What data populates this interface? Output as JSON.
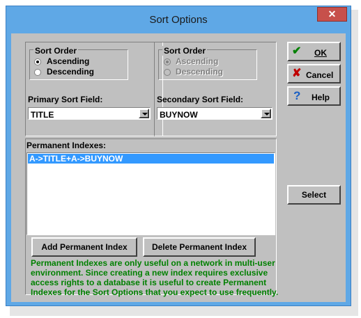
{
  "window": {
    "title": "Sort Options",
    "close_glyph": "✕"
  },
  "primary": {
    "group_label": "Sort Order",
    "ascending_label": "Ascending",
    "descending_label": "Descending",
    "selected": "Ascending",
    "field_label": "Primary Sort Field:",
    "field_value": "TITLE"
  },
  "secondary": {
    "group_label": "Sort Order",
    "ascending_label": "Ascending",
    "descending_label": "Descending",
    "selected": "Ascending",
    "field_label": "Secondary Sort Field:",
    "field_value": "BUYNOW"
  },
  "indexes": {
    "label": "Permanent Indexes:",
    "items": [
      "A->TITLE+A->BUYNOW"
    ],
    "selected_index": 0
  },
  "buttons": {
    "ok": "OK",
    "cancel": "Cancel",
    "help": "Help",
    "select": "Select",
    "add_index": "Add Permanent Index",
    "delete_index": "Delete Permanent Index"
  },
  "icons": {
    "ok": "checkmark-icon",
    "cancel": "x-icon",
    "help": "question-mark-icon"
  },
  "note": {
    "lines": [
      "Permanent Indexes are only useful on a network in multi-user",
      "environment. Since creating a new index requires exclusive",
      "access rights to a database it is useful to create Permanent",
      "Indexes for the Sort Options that you expect to use frequently."
    ]
  },
  "colors": {
    "note_text": "#008000",
    "selection": "#3399ff",
    "dialog_face": "#c0c0c0",
    "frame": "#5fa8e6"
  }
}
